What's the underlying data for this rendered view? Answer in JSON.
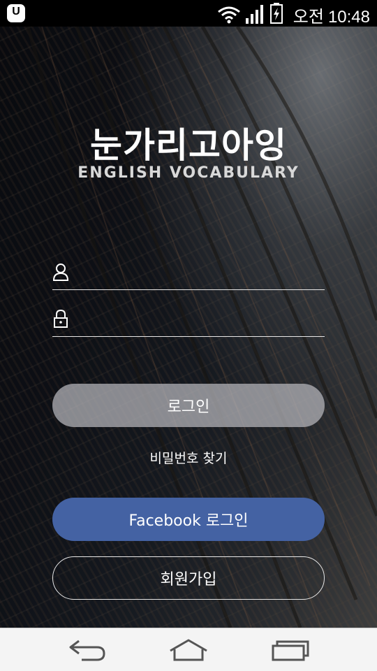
{
  "status_bar": {
    "app_icon": "uplus-icon",
    "icons": [
      "wifi-icon",
      "signal-icon",
      "battery-charging-icon"
    ],
    "ampm": "오전",
    "time": "10:48"
  },
  "logo": {
    "title": "눈가리고아잉",
    "subtitle": "ENGLISH VOCABULARY"
  },
  "form": {
    "username_icon": "user-icon",
    "password_icon": "lock-icon",
    "username_value": "",
    "password_value": ""
  },
  "buttons": {
    "login_label": "로그인",
    "find_password_label": "비밀번호 찾기",
    "facebook_login_label": "Facebook 로그인",
    "signup_label": "회원가입"
  },
  "colors": {
    "facebook": "#4462a3",
    "login_button": "#b9b9be"
  },
  "navigation": {
    "icons": [
      "back-icon",
      "home-icon",
      "recents-icon"
    ]
  }
}
